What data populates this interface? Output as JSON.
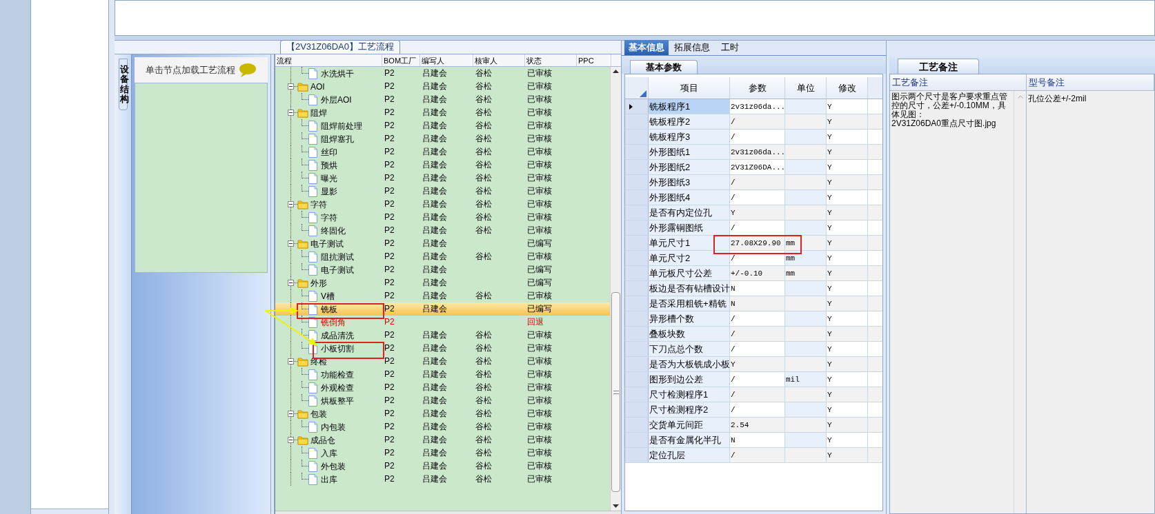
{
  "flow_panel": {
    "title": "【2V31Z06DA0】工艺流程",
    "side_tab": "设备结构",
    "hint": "单击节点加载工艺流程",
    "columns": [
      "流程",
      "BOM工厂",
      "编写人",
      "核审人",
      "状态",
      "PPC"
    ],
    "tree": [
      {
        "children": [
          {
            "kind": "file",
            "label": "水洗烘干",
            "bom": "P2",
            "writer": "吕建会",
            "reviewer": "谷松",
            "status": "已审核",
            "returned": false,
            "selected": false
          }
        ]
      },
      {
        "kind": "folder",
        "expanded": true,
        "label": "AOI",
        "bom": "P2",
        "writer": "吕建会",
        "reviewer": "谷松",
        "status": "已审核",
        "returned": false,
        "selected": false,
        "children": [
          {
            "kind": "file",
            "label": "外层AOI",
            "bom": "P2",
            "writer": "吕建会",
            "reviewer": "谷松",
            "status": "已审核",
            "returned": false,
            "selected": false
          }
        ]
      },
      {
        "kind": "folder",
        "expanded": true,
        "label": "阻焊",
        "bom": "P2",
        "writer": "吕建会",
        "reviewer": "谷松",
        "status": "已审核",
        "returned": false,
        "selected": false,
        "children": [
          {
            "kind": "file",
            "label": "阻焊前处理",
            "bom": "P2",
            "writer": "吕建会",
            "reviewer": "谷松",
            "status": "已审核",
            "returned": false,
            "selected": false
          },
          {
            "kind": "file",
            "label": "阻焊塞孔",
            "bom": "P2",
            "writer": "吕建会",
            "reviewer": "谷松",
            "status": "已审核",
            "returned": false,
            "selected": false
          },
          {
            "kind": "file",
            "label": "丝印",
            "bom": "P2",
            "writer": "吕建会",
            "reviewer": "谷松",
            "status": "已审核",
            "returned": false,
            "selected": false
          },
          {
            "kind": "file",
            "label": "预烘",
            "bom": "P2",
            "writer": "吕建会",
            "reviewer": "谷松",
            "status": "已审核",
            "returned": false,
            "selected": false
          },
          {
            "kind": "file",
            "label": "曝光",
            "bom": "P2",
            "writer": "吕建会",
            "reviewer": "谷松",
            "status": "已审核",
            "returned": false,
            "selected": false
          },
          {
            "kind": "file",
            "label": "显影",
            "bom": "P2",
            "writer": "吕建会",
            "reviewer": "谷松",
            "status": "已审核",
            "returned": false,
            "selected": false
          }
        ]
      },
      {
        "kind": "folder",
        "expanded": true,
        "label": "字符",
        "bom": "P2",
        "writer": "吕建会",
        "reviewer": "谷松",
        "status": "已审核",
        "returned": false,
        "selected": false,
        "children": [
          {
            "kind": "file",
            "label": "字符",
            "bom": "P2",
            "writer": "吕建会",
            "reviewer": "谷松",
            "status": "已审核",
            "returned": false,
            "selected": false
          },
          {
            "kind": "file",
            "label": "终固化",
            "bom": "P2",
            "writer": "吕建会",
            "reviewer": "谷松",
            "status": "已审核",
            "returned": false,
            "selected": false
          }
        ]
      },
      {
        "kind": "folder",
        "expanded": true,
        "label": "电子测试",
        "bom": "P2",
        "writer": "吕建会",
        "status": "已编写",
        "returned": false,
        "selected": false,
        "children": [
          {
            "kind": "file",
            "label": "阻抗测试",
            "bom": "P2",
            "writer": "吕建会",
            "reviewer": "谷松",
            "status": "已审核",
            "returned": false,
            "selected": false
          },
          {
            "kind": "file",
            "label": "电子测试",
            "bom": "P2",
            "writer": "吕建会",
            "status": "已编写",
            "returned": false,
            "selected": false
          }
        ]
      },
      {
        "kind": "folder",
        "expanded": true,
        "label": "外形",
        "bom": "P2",
        "writer": "吕建会",
        "status": "已编写",
        "returned": false,
        "selected": false,
        "children": [
          {
            "kind": "file",
            "label": "V槽",
            "bom": "P2",
            "writer": "吕建会",
            "reviewer": "谷松",
            "status": "已审核",
            "returned": false,
            "selected": false
          },
          {
            "kind": "file",
            "label": "铣板",
            "bom": "P2",
            "writer": "吕建会",
            "status": "已编写",
            "returned": false,
            "selected": true
          },
          {
            "kind": "file",
            "label": "铣倒角",
            "bom": "P2",
            "status": "回退",
            "returned": true,
            "selected": false
          },
          {
            "kind": "file",
            "label": "成品清洗",
            "bom": "P2",
            "writer": "吕建会",
            "reviewer": "谷松",
            "status": "已审核",
            "returned": false,
            "selected": false
          },
          {
            "kind": "file",
            "label": "小板切割",
            "bom": "P2",
            "writer": "吕建会",
            "reviewer": "谷松",
            "status": "已审核",
            "returned": false,
            "selected": false
          }
        ]
      },
      {
        "kind": "folder",
        "expanded": true,
        "label": "终检",
        "bom": "P2",
        "writer": "吕建会",
        "reviewer": "谷松",
        "status": "已审核",
        "returned": false,
        "selected": false,
        "children": [
          {
            "kind": "file",
            "label": "功能检查",
            "bom": "P2",
            "writer": "吕建会",
            "reviewer": "谷松",
            "status": "已审核",
            "returned": false,
            "selected": false
          },
          {
            "kind": "file",
            "label": "外观检查",
            "bom": "P2",
            "writer": "吕建会",
            "reviewer": "谷松",
            "status": "已审核",
            "returned": false,
            "selected": false
          },
          {
            "kind": "file",
            "label": "烘板整平",
            "bom": "P2",
            "writer": "吕建会",
            "reviewer": "谷松",
            "status": "已审核",
            "returned": false,
            "selected": false
          }
        ]
      },
      {
        "kind": "folder",
        "expanded": true,
        "label": "包装",
        "bom": "P2",
        "writer": "吕建会",
        "reviewer": "谷松",
        "status": "已审核",
        "returned": false,
        "selected": false,
        "children": [
          {
            "kind": "file",
            "label": "内包装",
            "bom": "P2",
            "writer": "吕建会",
            "reviewer": "谷松",
            "status": "已审核",
            "returned": false,
            "selected": false
          }
        ]
      },
      {
        "kind": "folder",
        "expanded": true,
        "label": "成品仓",
        "bom": "P2",
        "writer": "吕建会",
        "reviewer": "谷松",
        "status": "已审核",
        "returned": false,
        "selected": false,
        "children": [
          {
            "kind": "file",
            "label": "入库",
            "bom": "P2",
            "writer": "吕建会",
            "reviewer": "谷松",
            "status": "已审核",
            "returned": false,
            "selected": false
          },
          {
            "kind": "file",
            "label": "外包装",
            "bom": "P2",
            "writer": "吕建会",
            "reviewer": "谷松",
            "status": "已审核",
            "returned": false,
            "selected": false
          },
          {
            "kind": "file",
            "label": "出库",
            "bom": "P2",
            "writer": "吕建会",
            "reviewer": "谷松",
            "status": "已审核",
            "returned": false,
            "selected": false
          }
        ]
      }
    ]
  },
  "detail": {
    "tabs": [
      {
        "label": "基本信息",
        "selected": true
      },
      {
        "label": "拓展信息",
        "selected": false
      },
      {
        "label": "工时",
        "selected": false
      }
    ],
    "subtab": "基本参数",
    "columns": [
      "项目",
      "参数",
      "单位",
      "修改"
    ],
    "rows": [
      {
        "item": "铣板程序1",
        "param": "2v31z06da...",
        "edit": "Y",
        "selected": true
      },
      {
        "item": "铣板程序2",
        "param": "/",
        "edit": "Y",
        "selected": false
      },
      {
        "item": "铣板程序3",
        "param": "/",
        "edit": "Y",
        "selected": false
      },
      {
        "item": "外形图纸1",
        "param": "2v31z06da...",
        "edit": "Y",
        "selected": false
      },
      {
        "item": "外形图纸2",
        "param": "2V31Z06DA...",
        "edit": "Y",
        "selected": false
      },
      {
        "item": "外形图纸3",
        "param": "/",
        "edit": "Y",
        "selected": false
      },
      {
        "item": "外形图纸4",
        "param": "/",
        "edit": "Y",
        "selected": false
      },
      {
        "item": "是否有内定位孔",
        "param": "Y",
        "edit": "Y",
        "selected": false
      },
      {
        "item": "外形露铜图纸",
        "param": "/",
        "edit": "Y",
        "selected": false
      },
      {
        "item": "单元尺寸1",
        "param": "27.08X29.90",
        "unit": "mm",
        "edit": "Y",
        "selected": false
      },
      {
        "item": "单元尺寸2",
        "param": "/",
        "unit": "mm",
        "edit": "Y",
        "selected": false
      },
      {
        "item": "单元板尺寸公差",
        "param": "+/-0.10",
        "unit": "mm",
        "edit": "Y",
        "selected": false
      },
      {
        "item": "板边是否有钻槽设计",
        "param": "N",
        "edit": "Y",
        "selected": false
      },
      {
        "item": "是否采用粗铣+精铣",
        "param": "N",
        "edit": "Y",
        "selected": false
      },
      {
        "item": "异形槽个数",
        "param": "/",
        "edit": "Y",
        "selected": false
      },
      {
        "item": "叠板块数",
        "param": "/",
        "edit": "Y",
        "selected": false
      },
      {
        "item": "下刀点总个数",
        "param": "/",
        "edit": "Y",
        "selected": false
      },
      {
        "item": "是否为大板铣成小板",
        "param": "Y",
        "edit": "Y",
        "selected": false
      },
      {
        "item": "图形到边公差",
        "param": "/",
        "unit": "mil",
        "edit": "Y",
        "selected": false
      },
      {
        "item": "尺寸检测程序1",
        "param": "/",
        "edit": "Y",
        "selected": false
      },
      {
        "item": "尺寸检测程序2",
        "param": "/",
        "edit": "Y",
        "selected": false
      },
      {
        "item": "交货单元间距",
        "param": "2.54",
        "edit": "Y",
        "selected": false
      },
      {
        "item": "是否有金属化半孔",
        "param": "N",
        "edit": "Y",
        "selected": false
      },
      {
        "item": "定位孔层",
        "param": "/",
        "edit": "Y",
        "selected": false
      }
    ]
  },
  "notes": {
    "tab": "工艺备注",
    "columns": [
      "工艺备注",
      "型号备注"
    ],
    "process_note": "图示两个尺寸是客户要求重点管控的尺寸，公差+/-0.10MM，具体见图：\n2V31Z06DA0重点尺寸图.jpg",
    "model_note": "孔位公差+/-2mil"
  }
}
